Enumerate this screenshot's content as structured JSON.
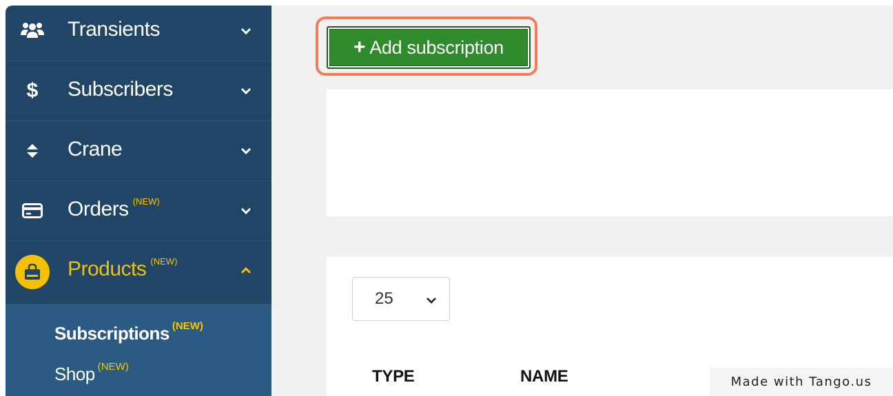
{
  "sidebar": {
    "items": [
      {
        "label": "Transients",
        "badge": "",
        "icon": "users-icon"
      },
      {
        "label": "Subscribers",
        "badge": "",
        "icon": "dollar-icon"
      },
      {
        "label": "Crane",
        "badge": "",
        "icon": "sort-arrows-icon"
      },
      {
        "label": "Orders",
        "badge": "(NEW)",
        "icon": "credit-card-icon"
      },
      {
        "label": "Products",
        "badge": "(NEW)",
        "icon": "shopping-bag-icon"
      }
    ],
    "sub_items": [
      {
        "label": "Subscriptions",
        "badge": "(NEW)"
      },
      {
        "label": "Shop",
        "badge": "(NEW)"
      }
    ]
  },
  "main": {
    "add_button": {
      "label": "Add subscription",
      "icon": "plus-icon"
    },
    "page_size": {
      "value": "25"
    },
    "table": {
      "columns": [
        "TYPE",
        "NAME"
      ]
    }
  },
  "watermark": "Made with Tango.us",
  "colors": {
    "sidebar_bg": "#214567",
    "active_accent": "#f5c000",
    "button_green": "#2f8b2c",
    "highlight_ring": "#f27b5a"
  }
}
